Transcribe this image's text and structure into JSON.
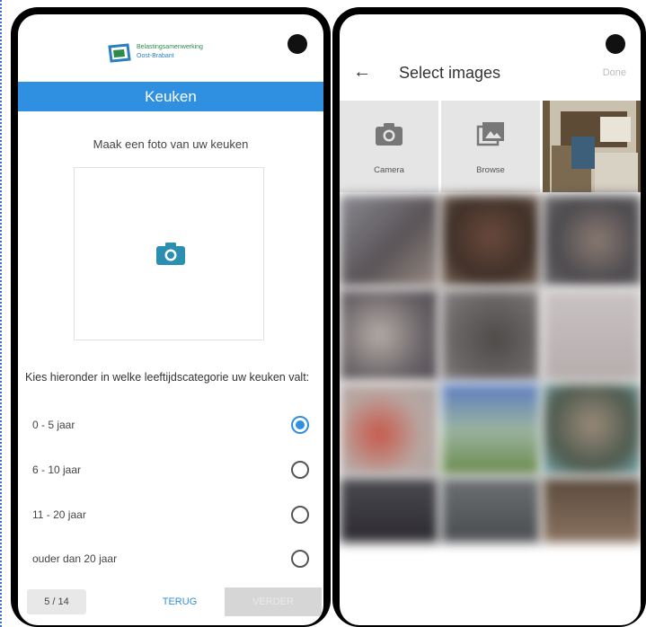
{
  "left_screen": {
    "logo": {
      "line1": "Belastingsamenwerking",
      "line2": "Oost-Brabant"
    },
    "title": "Keuken",
    "instruction": "Maak een foto van uw keuken",
    "question": "Kies hieronder in welke leeftijdscategorie uw keuken valt:",
    "options": [
      {
        "label": "0 - 5 jaar",
        "selected": true
      },
      {
        "label": "6 - 10 jaar",
        "selected": false
      },
      {
        "label": "11 - 20 jaar",
        "selected": false
      },
      {
        "label": "ouder dan 20 jaar",
        "selected": false
      }
    ],
    "footer": {
      "page_count": "5 / 14",
      "back_label": "TERUG",
      "next_label": "VERDER"
    },
    "accent_color": "#2f8fe0"
  },
  "right_screen": {
    "title": "Select images",
    "done_label": "Done",
    "actions": [
      {
        "label": "Camera",
        "icon": "camera-icon"
      },
      {
        "label": "Browse",
        "icon": "gallery-icon"
      }
    ]
  }
}
